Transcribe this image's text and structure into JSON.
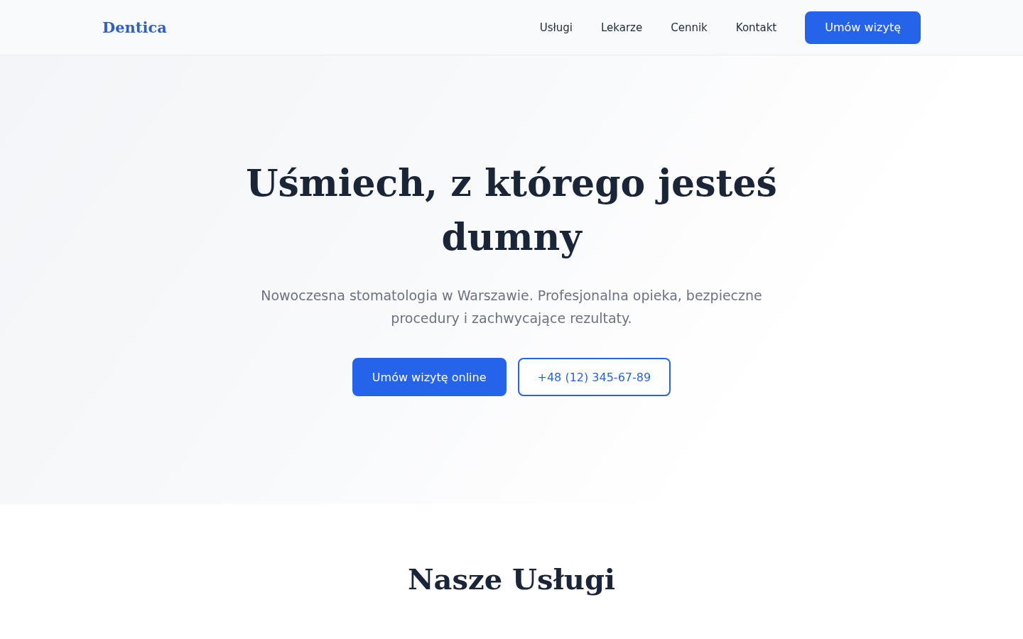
{
  "header": {
    "logo": "Dentica",
    "nav": [
      {
        "label": "Usługi"
      },
      {
        "label": "Lekarze"
      },
      {
        "label": "Cennik"
      },
      {
        "label": "Kontakt"
      }
    ],
    "cta": "Umów wizytę"
  },
  "hero": {
    "title": "Uśmiech, z którego jesteś dumny",
    "subtitle": "Nowoczesna stomatologia w Warszawie. Profesjonalna opieka, bezpieczne procedury i zachwycające rezultaty.",
    "buttons": [
      {
        "label": "Umów wizytę online",
        "kind": "primary"
      },
      {
        "label": "+48 (12) 345-67-89",
        "kind": "outline"
      }
    ]
  },
  "services": {
    "title": "Nasze Usługi"
  }
}
